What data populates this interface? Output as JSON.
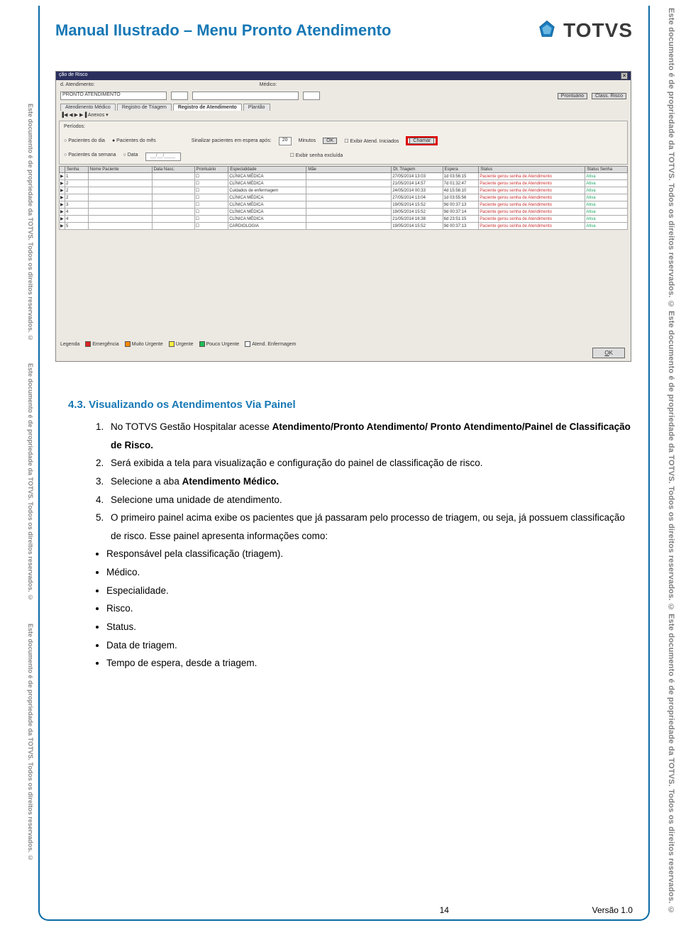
{
  "header": {
    "title": "Manual Ilustrado – Menu Pronto Atendimento",
    "logo_text": "TOTVS"
  },
  "watermark": "Este documento é de propriedade da TOTVS. Todos os direitos reservados. ©",
  "section": {
    "heading": "4.3. Visualizando os Atendimentos Via Painel",
    "steps": {
      "s1_pre": "No TOTVS Gestão Hospitalar acesse ",
      "s1_path": "Atendimento/Pronto Atendimento/ Pronto Atendimento/Painel de Classificação de Risco.",
      "s2": "Será exibida a tela para visualização e configuração do painel de classificação de risco.",
      "s3_pre": "Selecione a aba ",
      "s3_bold": "Atendimento Médico.",
      "s4": "Selecione uma unidade de atendimento.",
      "s5": "O primeiro painel acima exibe os pacientes que já passaram pelo processo de triagem, ou seja, já possuem classificação de risco. Esse painel apresenta informações como:"
    },
    "bullets": {
      "b1": "Responsável pela classificação (triagem).",
      "b2": "Médico.",
      "b3": "Especialidade.",
      "b4": "Risco.",
      "b5": "Status.",
      "b6": "Data de triagem.",
      "b7": "Tempo de espera, desde a triagem."
    }
  },
  "footer": {
    "page": "14",
    "version": "Versão 1.0"
  },
  "screenshot": {
    "title": "ção de Risco",
    "top_labels": {
      "atend": "d. Atendimento:",
      "medico": "Médico:"
    },
    "atend_value": "PRONTO ATENDIMENTO",
    "buttons": {
      "prontuario": "Prontuário",
      "class": "Class. Risco",
      "chamar": "Chamar",
      "ok": "OK"
    },
    "tabs": {
      "t1": "Atendimento Médico",
      "t2": "Registro de Triagem",
      "t3": "Registro de Atendimento",
      "t4": "Plantão"
    },
    "pager": "▐◀ ◀ ▶ ▶▐  Anexos ▾",
    "filters": {
      "title": "Períodos:",
      "r1": "Pacientes do dia",
      "r2": "Pacientes do mês",
      "r3": "Pacientes da semana",
      "r4": "Data",
      "sinal": "Sinalizar pacientes em espera após:",
      "min_val": "20",
      "min_lbl": "Minutos",
      "c1": "Exibir Atend. Iniciados",
      "c2": "Exibir senha excluída"
    },
    "columns": {
      "c0": "",
      "c1": "Senha",
      "c2": "Nome Paciente",
      "c3": "Data Nasc.",
      "c4": "Prontuário",
      "c5": "Especialidade",
      "c6": "Mãe",
      "c7": "Dt. Triagem",
      "c8": "Espera",
      "c9": "Status",
      "c10": "Status Senha"
    },
    "rows": [
      {
        "s": "1",
        "esp": "CLÍNICA MÉDICA",
        "dt": "27/05/2014 13:03",
        "e": "1d 03:56:15",
        "st": "Paciente gerou senha de Atendimento",
        "ss": "Ativa"
      },
      {
        "s": "2",
        "esp": "CLÍNICA MÉDICA",
        "dt": "21/05/2014 14:57",
        "e": "7d 01:32:47",
        "st": "Paciente gerou senha de Atendimento",
        "ss": "Ativa"
      },
      {
        "s": "2",
        "esp": "Cuidados de enfermagem",
        "dt": "24/05/2014 00:33",
        "e": "4d 15:56:10",
        "st": "Paciente gerou senha de Atendimento",
        "ss": "Ativa"
      },
      {
        "s": "2",
        "esp": "CLÍNICA MÉDICA",
        "dt": "27/05/2014 13:04",
        "e": "1d 03:55:56",
        "st": "Paciente gerou senha de Atendimento",
        "ss": "Ativa"
      },
      {
        "s": "3",
        "esp": "CLÍNICA MÉDICA",
        "dt": "19/05/2014 15:52",
        "e": "9d 00:37:13",
        "st": "Paciente gerou senha de Atendimento",
        "ss": "Ativa"
      },
      {
        "s": "4",
        "esp": "CLÍNICA MÉDICA",
        "dt": "19/05/2014 15:52",
        "e": "9d 00:37:14",
        "st": "Paciente gerou senha de Atendimento",
        "ss": "Ativa"
      },
      {
        "s": "4",
        "esp": "CLÍNICA MÉDICA",
        "dt": "21/05/2014 16:38",
        "e": "6d 23:51:15",
        "st": "Paciente gerou senha de Atendimento",
        "ss": "Ativa"
      },
      {
        "s": "5",
        "esp": "CARDIOLOGIA",
        "dt": "19/05/2014 15:52",
        "e": "9d 00:37:13",
        "st": "Paciente gerou senha de Atendimento",
        "ss": "Ativa"
      }
    ],
    "legend": {
      "title": "Legenda",
      "l1": "Emergência",
      "l2": "Muito Urgente",
      "l3": "Urgente",
      "l4": "Pouco Urgente",
      "l5": "Atend. Enfermagem"
    }
  }
}
